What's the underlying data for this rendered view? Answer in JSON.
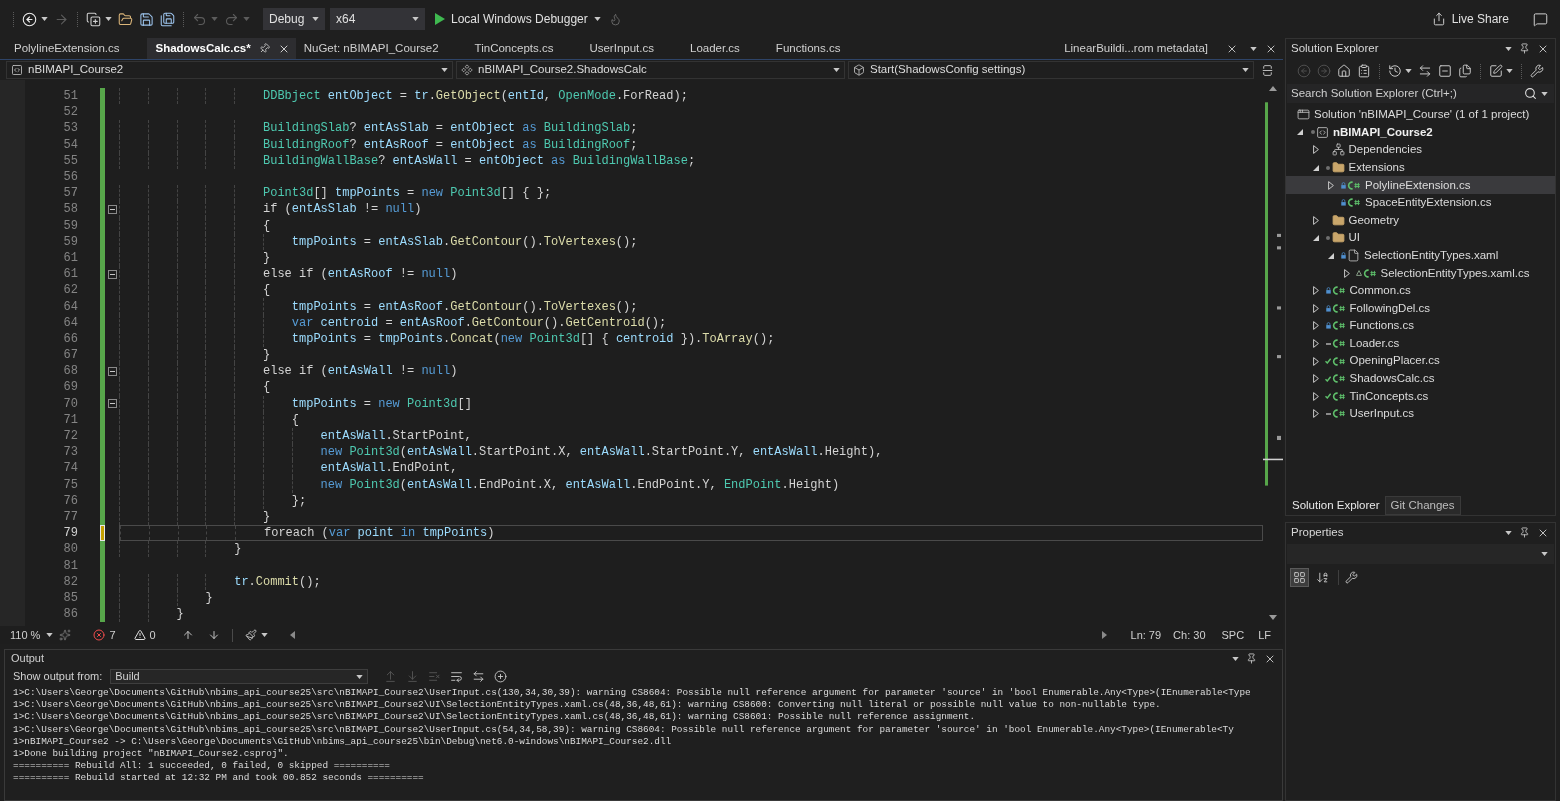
{
  "toolbar": {
    "buttons": [
      {
        "kind": "back",
        "disabled": false
      },
      {
        "kind": "forward",
        "disabled": true
      },
      {
        "kind": "new_project",
        "disabled": false
      },
      {
        "kind": "open",
        "disabled": false
      },
      {
        "kind": "save",
        "disabled": false
      },
      {
        "kind": "save_all",
        "disabled": false
      },
      {
        "kind": "undo",
        "disabled": true
      },
      {
        "kind": "redo",
        "disabled": true
      }
    ],
    "configuration": "Debug",
    "platform": "x64",
    "run_target": "Local Windows Debugger",
    "live_share": "Live Share"
  },
  "document_tabs": [
    {
      "label": "PolylineExtension.cs",
      "selected": false
    },
    {
      "label": "ShadowsCalc.cs*",
      "selected": true
    },
    {
      "label": "NuGet: nBIMAPI_Course2",
      "selected": false
    },
    {
      "label": "TinConcepts.cs",
      "selected": false
    },
    {
      "label": "UserInput.cs",
      "selected": false
    },
    {
      "label": "Loader.cs",
      "selected": false
    },
    {
      "label": "Functions.cs",
      "selected": false
    }
  ],
  "preview_tab": "LinearBuildi...rom metadata]",
  "navigation_bar": {
    "project": "nBIMAPI_Course2",
    "type": "nBIMAPI_Course2.ShadowsCalc",
    "member": "Start(ShadowsConfig settings)"
  },
  "editor": {
    "lines": [
      {
        "number": "51",
        "current": false,
        "collapsible": false,
        "unsaved": false,
        "tokens": [
          {
            "text": "                    DDBbject ",
            "kind": "type"
          },
          {
            "text": "entObject",
            "kind": "local"
          },
          {
            "text": " = ",
            "kind": "plain"
          },
          {
            "text": "tr",
            "kind": "local"
          },
          {
            "text": ".",
            "kind": "plain"
          },
          {
            "text": "GetObject",
            "kind": "method"
          },
          {
            "text": "(",
            "kind": "plain"
          },
          {
            "text": "entId",
            "kind": "local"
          },
          {
            "text": ", ",
            "kind": "plain"
          },
          {
            "text": "OpenMode",
            "kind": "type"
          },
          {
            "text": ".ForRead);",
            "kind": "plain"
          }
        ]
      },
      {
        "number": "52",
        "current": false,
        "collapsible": false,
        "unsaved": false
      },
      {
        "number": "53",
        "current": false,
        "collapsible": false,
        "unsaved": false,
        "tokens": [
          {
            "text": "                    BuildingSlab",
            "kind": "type"
          },
          {
            "text": "? ",
            "kind": "plain"
          },
          {
            "text": "entAsSlab",
            "kind": "local"
          },
          {
            "text": " = ",
            "kind": "plain"
          },
          {
            "text": "entObject",
            "kind": "local"
          },
          {
            "text": " as ",
            "kind": "keyword"
          },
          {
            "text": "BuildingSlab",
            "kind": "type"
          },
          {
            "text": ";",
            "kind": "plain"
          }
        ]
      },
      {
        "number": "54",
        "current": false,
        "collapsible": false,
        "unsaved": false,
        "tokens": [
          {
            "text": "                    BuildingRoof",
            "kind": "type"
          },
          {
            "text": "? ",
            "kind": "plain"
          },
          {
            "text": "entAsRoof",
            "kind": "local"
          },
          {
            "text": " = ",
            "kind": "plain"
          },
          {
            "text": "entObject",
            "kind": "local"
          },
          {
            "text": " as ",
            "kind": "keyword"
          },
          {
            "text": "BuildingRoof",
            "kind": "type"
          },
          {
            "text": ";",
            "kind": "plain"
          }
        ]
      },
      {
        "number": "55",
        "current": false,
        "collapsible": false,
        "unsaved": false,
        "tokens": [
          {
            "text": "                    BuildingWallBase",
            "kind": "type"
          },
          {
            "text": "? ",
            "kind": "plain"
          },
          {
            "text": "entAsWall",
            "kind": "local"
          },
          {
            "text": " = ",
            "kind": "plain"
          },
          {
            "text": "entObject",
            "kind": "local"
          },
          {
            "text": " as ",
            "kind": "keyword"
          },
          {
            "text": "BuildingWallBase",
            "kind": "type"
          },
          {
            "text": ";",
            "kind": "plain"
          }
        ]
      },
      {
        "number": "56",
        "current": false,
        "collapsible": false,
        "unsaved": false
      },
      {
        "number": "57",
        "current": false,
        "collapsible": false,
        "unsaved": false,
        "tokens": [
          {
            "text": "                    Point3d",
            "kind": "type"
          },
          {
            "text": "[] ",
            "kind": "plain"
          },
          {
            "text": "tmpPoints",
            "kind": "local"
          },
          {
            "text": " = ",
            "kind": "plain"
          },
          {
            "text": "new ",
            "kind": "keyword"
          },
          {
            "text": "Point3d",
            "kind": "type"
          },
          {
            "text": "[] { };",
            "kind": "plain"
          }
        ]
      },
      {
        "number": "58",
        "current": false,
        "collapsible": true,
        "unsaved": false,
        "tokens": [
          {
            "text": "                    if (",
            "kind": "plain"
          },
          {
            "text": "entAsSlab",
            "kind": "local"
          },
          {
            "text": " != ",
            "kind": "plain"
          },
          {
            "text": "null",
            "kind": "keyword"
          },
          {
            "text": ")",
            "kind": "plain"
          }
        ]
      },
      {
        "number": "59",
        "current": false,
        "collapsible": false,
        "unsaved": false,
        "tokens": [
          {
            "text": "                    {",
            "kind": "plain"
          }
        ]
      },
      {
        "number": "59",
        "current": false,
        "collapsible": false,
        "unsaved": false,
        "tokens": [
          {
            "text": "                        tmpPoints",
            "kind": "local"
          },
          {
            "text": " = ",
            "kind": "plain"
          },
          {
            "text": "entAsSlab",
            "kind": "local"
          },
          {
            "text": ".",
            "kind": "plain"
          },
          {
            "text": "GetContour",
            "kind": "method"
          },
          {
            "text": "().",
            "kind": "plain"
          },
          {
            "text": "ToVertexes",
            "kind": "method"
          },
          {
            "text": "();",
            "kind": "plain"
          }
        ]
      },
      {
        "number": "61",
        "current": false,
        "collapsible": false,
        "unsaved": false,
        "tokens": [
          {
            "text": "                    }",
            "kind": "plain"
          }
        ]
      },
      {
        "number": "61",
        "current": false,
        "collapsible": true,
        "unsaved": false,
        "tokens": [
          {
            "text": "                    else if (",
            "kind": "plain"
          },
          {
            "text": "entAsRoof",
            "kind": "local"
          },
          {
            "text": " != ",
            "kind": "plain"
          },
          {
            "text": "null",
            "kind": "keyword"
          },
          {
            "text": ")",
            "kind": "plain"
          }
        ]
      },
      {
        "number": "62",
        "current": false,
        "collapsible": false,
        "unsaved": false,
        "tokens": [
          {
            "text": "                    {",
            "kind": "plain"
          }
        ]
      },
      {
        "number": "64",
        "current": false,
        "collapsible": false,
        "unsaved": false,
        "tokens": [
          {
            "text": "                        tmpPoints",
            "kind": "local"
          },
          {
            "text": " = ",
            "kind": "plain"
          },
          {
            "text": "entAsRoof",
            "kind": "local"
          },
          {
            "text": ".",
            "kind": "plain"
          },
          {
            "text": "GetContour",
            "kind": "method"
          },
          {
            "text": "().",
            "kind": "plain"
          },
          {
            "text": "ToVertexes",
            "kind": "method"
          },
          {
            "text": "();",
            "kind": "plain"
          }
        ]
      },
      {
        "number": "64",
        "current": false,
        "collapsible": false,
        "unsaved": false,
        "tokens": [
          {
            "text": "                        var ",
            "kind": "keyword"
          },
          {
            "text": "centroid",
            "kind": "local"
          },
          {
            "text": " = ",
            "kind": "plain"
          },
          {
            "text": "entAsRoof",
            "kind": "local"
          },
          {
            "text": ".",
            "kind": "plain"
          },
          {
            "text": "GetContour",
            "kind": "method"
          },
          {
            "text": "().",
            "kind": "plain"
          },
          {
            "text": "GetCentroid",
            "kind": "method"
          },
          {
            "text": "();",
            "kind": "plain"
          }
        ]
      },
      {
        "number": "66",
        "current": false,
        "collapsible": false,
        "unsaved": false,
        "tokens": [
          {
            "text": "                        tmpPoints",
            "kind": "local"
          },
          {
            "text": " = ",
            "kind": "plain"
          },
          {
            "text": "tmpPoints",
            "kind": "local"
          },
          {
            "text": ".",
            "kind": "plain"
          },
          {
            "text": "Concat",
            "kind": "method"
          },
          {
            "text": "(",
            "kind": "plain"
          },
          {
            "text": "new ",
            "kind": "keyword"
          },
          {
            "text": "Point3d",
            "kind": "type"
          },
          {
            "text": "[] { ",
            "kind": "plain"
          },
          {
            "text": "centroid",
            "kind": "local"
          },
          {
            "text": " }).",
            "kind": "plain"
          },
          {
            "text": "ToArray",
            "kind": "method"
          },
          {
            "text": "();",
            "kind": "plain"
          }
        ]
      },
      {
        "number": "67",
        "current": false,
        "collapsible": false,
        "unsaved": false,
        "tokens": [
          {
            "text": "                    }",
            "kind": "plain"
          }
        ]
      },
      {
        "number": "68",
        "current": false,
        "collapsible": true,
        "unsaved": false,
        "tokens": [
          {
            "text": "                    else if (",
            "kind": "plain"
          },
          {
            "text": "entAsWall",
            "kind": "local"
          },
          {
            "text": " != ",
            "kind": "plain"
          },
          {
            "text": "null",
            "kind": "keyword"
          },
          {
            "text": ")",
            "kind": "plain"
          }
        ]
      },
      {
        "number": "69",
        "current": false,
        "collapsible": false,
        "unsaved": false,
        "tokens": [
          {
            "text": "                    {",
            "kind": "plain"
          }
        ]
      },
      {
        "number": "70",
        "current": false,
        "collapsible": true,
        "unsaved": false,
        "tokens": [
          {
            "text": "                        tmpPoints",
            "kind": "local"
          },
          {
            "text": " = ",
            "kind": "plain"
          },
          {
            "text": "new ",
            "kind": "keyword"
          },
          {
            "text": "Point3d",
            "kind": "type"
          },
          {
            "text": "[]",
            "kind": "plain"
          }
        ]
      },
      {
        "number": "71",
        "current": false,
        "collapsible": false,
        "unsaved": false,
        "tokens": [
          {
            "text": "                        {",
            "kind": "plain"
          }
        ]
      },
      {
        "number": "72",
        "current": false,
        "collapsible": false,
        "unsaved": false,
        "tokens": [
          {
            "text": "                            entAsWall",
            "kind": "local"
          },
          {
            "text": ".StartPoint,",
            "kind": "plain"
          }
        ]
      },
      {
        "number": "73",
        "current": false,
        "collapsible": false,
        "unsaved": false,
        "tokens": [
          {
            "text": "                            new ",
            "kind": "keyword"
          },
          {
            "text": "Point3d",
            "kind": "type"
          },
          {
            "text": "(",
            "kind": "plain"
          },
          {
            "text": "entAsWall",
            "kind": "local"
          },
          {
            "text": ".StartPoint.X, ",
            "kind": "plain"
          },
          {
            "text": "entAsWall",
            "kind": "local"
          },
          {
            "text": ".StartPoint.Y, ",
            "kind": "plain"
          },
          {
            "text": "entAsWall",
            "kind": "local"
          },
          {
            "text": ".Height),",
            "kind": "plain"
          }
        ]
      },
      {
        "number": "74",
        "current": false,
        "collapsible": false,
        "unsaved": false,
        "tokens": [
          {
            "text": "                            entAsWall",
            "kind": "local"
          },
          {
            "text": ".EndPoint,",
            "kind": "plain"
          }
        ]
      },
      {
        "number": "75",
        "current": false,
        "collapsible": false,
        "unsaved": false,
        "tokens": [
          {
            "text": "                            new ",
            "kind": "keyword"
          },
          {
            "text": "Point3d",
            "kind": "type"
          },
          {
            "text": "(",
            "kind": "plain"
          },
          {
            "text": "entAsWall",
            "kind": "local"
          },
          {
            "text": ".EndPoint.X, ",
            "kind": "plain"
          },
          {
            "text": "entAsWall",
            "kind": "local"
          },
          {
            "text": ".EndPoint.Y, ",
            "kind": "plain"
          },
          {
            "text": "EndPoint",
            "kind": "type"
          },
          {
            "text": ".Height)",
            "kind": "plain"
          }
        ]
      },
      {
        "number": "76",
        "current": false,
        "collapsible": false,
        "unsaved": false,
        "tokens": [
          {
            "text": "                        };",
            "kind": "plain"
          }
        ]
      },
      {
        "number": "77",
        "current": false,
        "collapsible": false,
        "unsaved": false,
        "tokens": [
          {
            "text": "                    }",
            "kind": "plain"
          }
        ]
      },
      {
        "number": "79",
        "current": true,
        "collapsible": false,
        "unsaved": true,
        "tokens": [
          {
            "text": "                    foreach (",
            "kind": "plain"
          },
          {
            "text": "var ",
            "kind": "keyword"
          },
          {
            "text": "point",
            "kind": "local"
          },
          {
            "text": " in ",
            "kind": "keyword"
          },
          {
            "text": "tmpPoints",
            "kind": "local"
          },
          {
            "text": ")",
            "kind": "plain"
          }
        ]
      },
      {
        "number": "80",
        "current": false,
        "collapsible": false,
        "unsaved": false,
        "tokens": [
          {
            "text": "                }",
            "kind": "plain"
          }
        ]
      },
      {
        "number": "81",
        "current": false,
        "collapsible": false,
        "unsaved": false
      },
      {
        "number": "82",
        "current": false,
        "collapsible": false,
        "unsaved": false,
        "tokens": [
          {
            "text": "                tr",
            "kind": "local"
          },
          {
            "text": ".",
            "kind": "plain"
          },
          {
            "text": "Commit",
            "kind": "method"
          },
          {
            "text": "();",
            "kind": "plain"
          }
        ]
      },
      {
        "number": "85",
        "current": false,
        "collapsible": false,
        "unsaved": false,
        "tokens": [
          {
            "text": "            }",
            "kind": "plain"
          }
        ]
      },
      {
        "number": "86",
        "current": false,
        "collapsible": false,
        "unsaved": false,
        "tokens": [
          {
            "text": "        }",
            "kind": "plain"
          }
        ]
      }
    ]
  },
  "editor_status": {
    "zoom": "110 %",
    "errors": "7",
    "warnings": "0",
    "line": "Ln: 79",
    "column": "Ch: 30",
    "whitespace": "SPC",
    "line_ending": "LF"
  },
  "output": {
    "title": "Output",
    "source_label": "Show output from:",
    "source": "Build",
    "toolbar": [
      {
        "kind": "previous",
        "disabled": true
      },
      {
        "kind": "next",
        "disabled": true
      },
      {
        "kind": "clear",
        "disabled": true
      },
      {
        "kind": "wrap",
        "disabled": false
      },
      {
        "kind": "sync",
        "disabled": false
      },
      {
        "kind": "add",
        "disabled": false
      }
    ],
    "lines": [
      "1>C:\\Users\\George\\Documents\\GitHub\\nbims_api_course25\\src\\nBIMAPI_Course2\\UserInput.cs(130,34,30,39): warning CS8604: Possible null reference argument for parameter 'source' in 'bool Enumerable.Any<Type>(IEnumerable<Type",
      "1>C:\\Users\\George\\Documents\\GitHub\\nbims_api_course25\\src\\nBIMAPI_Course2\\UI\\SelectionEntityTypes.xaml.cs(48,36,48,61): warning CS8600: Converting null literal or possible null value to non-nullable type.",
      "1>C:\\Users\\George\\Documents\\GitHub\\nbims_api_course25\\src\\nBIMAPI_Course2\\UI\\SelectionEntityTypes.xaml.cs(48,36,48,61): warning CS8601: Possible null reference assignment.",
      "1>C:\\Users\\George\\Documents\\GitHub\\nbims_api_course25\\src\\nBIMAPI_Course2\\UserInput.cs(54,34,58,39): warning CS8604: Possible null reference argument for parameter 'source' in 'bool Enumerable.Any<Type>(IEnumerable<Ty",
      "1>nBIMAPI_Course2 -> C:\\Users\\George\\Documents\\GitHub\\nbims_api_course25\\bin\\Debug\\net6.0-windows\\nBIMAPI_Course2.dll",
      "1>Done building project \"nBIMAPI_Course2.csproj\".",
      "========== Rebuild All: 1 succeeded, 0 failed, 0 skipped ==========",
      "========== Rebuild started at 12:32 PM and took 00.852 seconds =========="
    ]
  },
  "solution_explorer": {
    "title": "Solution Explorer",
    "toolbar": [
      {
        "kind": "back",
        "disabled": true
      },
      {
        "kind": "forward",
        "disabled": true
      },
      {
        "kind": "home",
        "disabled": false
      },
      {
        "kind": "pending_changes",
        "disabled": false
      },
      {
        "kind": "history",
        "disabled": false
      },
      {
        "kind": "sync",
        "disabled": false
      },
      {
        "kind": "collapse",
        "disabled": false
      },
      {
        "kind": "show_all",
        "disabled": false
      },
      {
        "kind": "preview",
        "disabled": false
      },
      {
        "kind": "properties",
        "disabled": false
      }
    ],
    "search": {
      "placeholder": "Search Solution Explorer (Ctrl+;)"
    },
    "tree": [
      {
        "label": "Solution 'nBIMAPI_Course' (1 of 1 project)",
        "kind": "solution",
        "selected": false,
        "children": [
          {
            "label": "nBIMAPI_Course2",
            "kind": "project",
            "expanded": true,
            "source_control": {
              "kind": "dot"
            },
            "selected": false,
            "children": [
              {
                "label": "Dependencies",
                "kind": "dependencies",
                "expanded": false,
                "selected": false
              },
              {
                "label": "Extensions",
                "kind": "folder",
                "expanded": true,
                "source_control": {
                  "kind": "dot"
                },
                "selected": false,
                "children": [
                  {
                    "label": "PolylineExtension.cs",
                    "kind": "csharp",
                    "expanded": false,
                    "source_control": {
                      "kind": "lock"
                    },
                    "selected": true
                  },
                  {
                    "label": "SpaceEntityExtension.cs",
                    "kind": "csharp",
                    "source_control": {
                      "kind": "lock"
                    },
                    "selected": false
                  }
                ]
              },
              {
                "label": "Geometry",
                "kind": "folder",
                "expanded": false,
                "selected": false
              },
              {
                "label": "UI",
                "kind": "folder",
                "expanded": true,
                "source_control": {
                  "kind": "dot"
                },
                "selected": false,
                "children": [
                  {
                    "label": "SelectionEntityTypes.xaml",
                    "kind": "xaml",
                    "expanded": true,
                    "source_control": {
                      "kind": "lock"
                    },
                    "selected": false,
                    "children": [
                      {
                        "label": "SelectionEntityTypes.xaml.cs",
                        "kind": "csharp",
                        "expanded": false,
                        "source_control": {
                          "kind": "triangle"
                        },
                        "selected": false
                      }
                    ]
                  }
                ]
              },
              {
                "label": "Common.cs",
                "kind": "csharp",
                "expanded": false,
                "source_control": {
                  "kind": "lock"
                },
                "selected": false
              },
              {
                "label": "FollowingDel.cs",
                "kind": "csharp",
                "expanded": false,
                "source_control": {
                  "kind": "lock"
                },
                "selected": false
              },
              {
                "label": "Functions.cs",
                "kind": "csharp",
                "expanded": false,
                "source_control": {
                  "kind": "lock"
                },
                "selected": false
              },
              {
                "label": "Loader.cs",
                "kind": "csharp",
                "expanded": false,
                "source_control": {
                  "kind": "dash"
                },
                "selected": false
              },
              {
                "label": "OpeningPlacer.cs",
                "kind": "csharp",
                "expanded": false,
                "source_control": {
                  "kind": "check"
                },
                "selected": false
              },
              {
                "label": "ShadowsCalc.cs",
                "kind": "csharp",
                "expanded": false,
                "source_control": {
                  "kind": "check"
                },
                "selected": false
              },
              {
                "label": "TinConcepts.cs",
                "kind": "csharp",
                "expanded": false,
                "source_control": {
                  "kind": "check"
                },
                "selected": false
              },
              {
                "label": "UserInput.cs",
                "kind": "csharp",
                "expanded": false,
                "source_control": {
                  "kind": "dash"
                },
                "selected": false
              }
            ]
          }
        ]
      }
    ],
    "tabs": [
      {
        "label": "Solution Explorer",
        "selected": true
      },
      {
        "label": "Git Changes",
        "selected": false
      }
    ]
  },
  "properties": {
    "title": "Properties",
    "toolbar": [
      {
        "kind": "categorized",
        "selected": true
      },
      {
        "kind": "alphabetical",
        "selected": false
      }
    ]
  }
}
